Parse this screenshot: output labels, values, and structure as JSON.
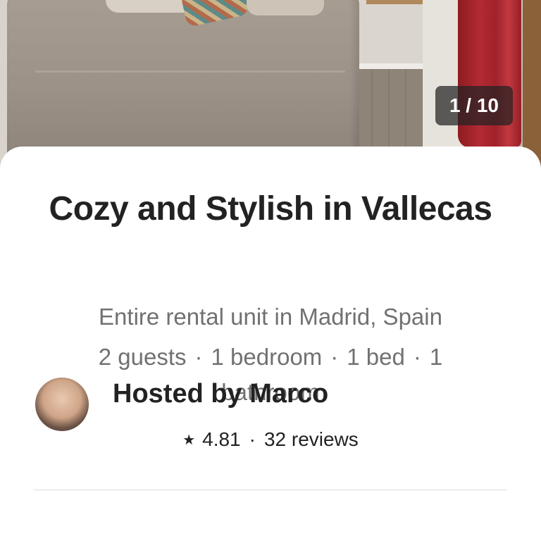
{
  "gallery": {
    "counter": "1 / 10"
  },
  "listing": {
    "title": "Cozy and Stylish in Vallecas",
    "subtitle": "Entire rental unit in Madrid, Spain",
    "details": {
      "guests": "2 guests",
      "bedrooms": "1 bedroom",
      "beds": "1 bed",
      "bathrooms": "1 bathroom",
      "separator": "·"
    },
    "rating": {
      "star_icon": "star-icon",
      "star_glyph": "★",
      "score": "4.81",
      "separator": "·",
      "reviews": "32 reviews"
    }
  },
  "host": {
    "label": "Hosted by Marco"
  }
}
